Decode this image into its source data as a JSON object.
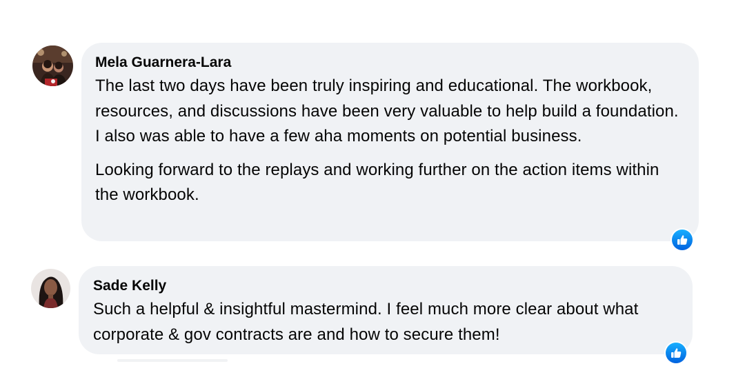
{
  "comments": [
    {
      "author": "Mela Guarnera-Lara",
      "paragraphs": [
        "The last two days have been truly inspiring and educational. The workbook, resources, and discussions have been very valuable to help build a foundation. I also was able to have a few aha moments on potential business.",
        "Looking forward to the replays and working further on the action items within the workbook."
      ],
      "reaction_icon": "like-icon"
    },
    {
      "author": "Sade Kelly",
      "paragraphs": [
        "Such a helpful & insightful mastermind. I feel much more clear about what corporate & gov contracts are and how to secure them!"
      ],
      "reaction_icon": "like-icon"
    }
  ],
  "colors": {
    "bubble": "#f0f2f5",
    "text": "#050505",
    "like_top": "#18afff",
    "like_bottom": "#0062df"
  }
}
